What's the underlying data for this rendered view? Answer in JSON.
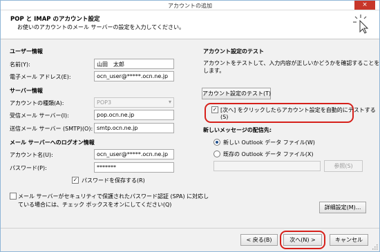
{
  "window": {
    "title": "アカウントの追加",
    "close_label": "×"
  },
  "header": {
    "title": "POP と IMAP のアカウント設定",
    "subtitle": "お使いのアカウントのメール サーバーの設定を入力してください。"
  },
  "user_info": {
    "heading": "ユーザー情報",
    "name_label": "名前(Y):",
    "name_value": "山田　太郎",
    "email_label": "電子メール アドレス(E):",
    "email_value": "ocn_user@*****.ocn.ne.jp"
  },
  "server_info": {
    "heading": "サーバー情報",
    "account_type_label": "アカウントの種類(A):",
    "account_type_value": "POP3",
    "incoming_label": "受信メール サーバー(I):",
    "incoming_value": "pop.ocn.ne.jp",
    "outgoing_label": "送信メール サーバー (SMTP)(O):",
    "outgoing_value": "smtp.ocn.ne.jp"
  },
  "login_info": {
    "heading": "メール サーバーへのログオン情報",
    "account_name_label": "アカウント名(U):",
    "account_name_value": "ocn_user@*****.ocn.ne.jp",
    "password_label": "パスワード(P):",
    "password_value": "*******",
    "save_password_label": "パスワードを保存する(R)",
    "spa_label_line1": "メール サーバーがセキュリティで保護されたパスワード認証 (SPA) に対応し",
    "spa_label_line2": "ている場合には、チェック ボックスをオンにしてください(Q)"
  },
  "test": {
    "heading": "アカウント設定のテスト",
    "desc_line1": "アカウントをテストして、入力内容が正しいかどうかを確認することをお勧め",
    "desc_line2": "します。",
    "test_button": "アカウント設定のテスト(T)",
    "auto_test_line1": "[次へ] をクリックしたらアカウント設定を自動的にテストする",
    "auto_test_line2": "(S)"
  },
  "delivery": {
    "heading": "新しいメッセージの配信先:",
    "new_file_label": "新しい Outlook データ ファイル(W)",
    "existing_file_label": "既存の Outlook データ ファイル(X)",
    "browse_button": "参照(S)"
  },
  "buttons": {
    "more_settings": "詳細設定(M)...",
    "back": "< 戻る(B)",
    "next": "次へ(N) >",
    "cancel": "キャンセル"
  },
  "colors": {
    "highlight_ring": "#d6201a",
    "window_border": "#8fb5d6",
    "close_button": "#c7362a"
  }
}
